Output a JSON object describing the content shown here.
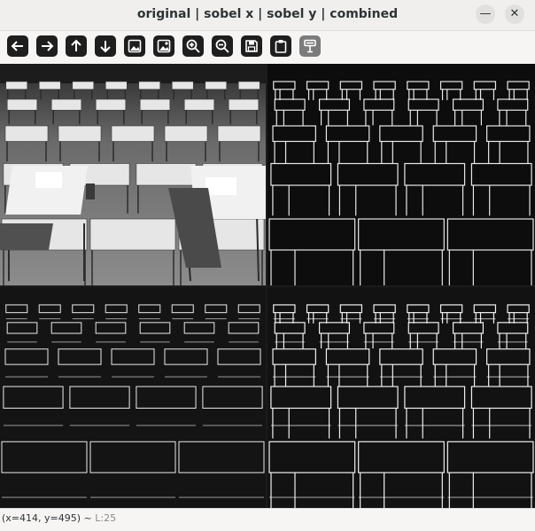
{
  "window": {
    "title": "original | sobel x | sobel y | combined",
    "minimize_glyph": "—",
    "close_glyph": "✕"
  },
  "toolbar": {
    "buttons": [
      {
        "name": "arrow-left-icon",
        "enabled": true
      },
      {
        "name": "arrow-right-icon",
        "enabled": true
      },
      {
        "name": "arrow-up-icon",
        "enabled": true
      },
      {
        "name": "arrow-down-icon",
        "enabled": true
      },
      {
        "name": "image-icon",
        "enabled": true
      },
      {
        "name": "image-settings-icon",
        "enabled": true
      },
      {
        "name": "zoom-in-icon",
        "enabled": true
      },
      {
        "name": "zoom-out-icon",
        "enabled": true
      },
      {
        "name": "save-icon",
        "enabled": true
      },
      {
        "name": "clipboard-icon",
        "enabled": true
      },
      {
        "name": "properties-icon",
        "enabled": false
      }
    ]
  },
  "panels": [
    {
      "name": "original-image-panel",
      "style": "original"
    },
    {
      "name": "sobel-x-image-panel",
      "style": "edges"
    },
    {
      "name": "sobel-y-image-panel",
      "style": "edges"
    },
    {
      "name": "combined-image-panel",
      "style": "edges"
    }
  ],
  "status": {
    "coords": "(x=414, y=495) ~",
    "level": "L:25"
  }
}
